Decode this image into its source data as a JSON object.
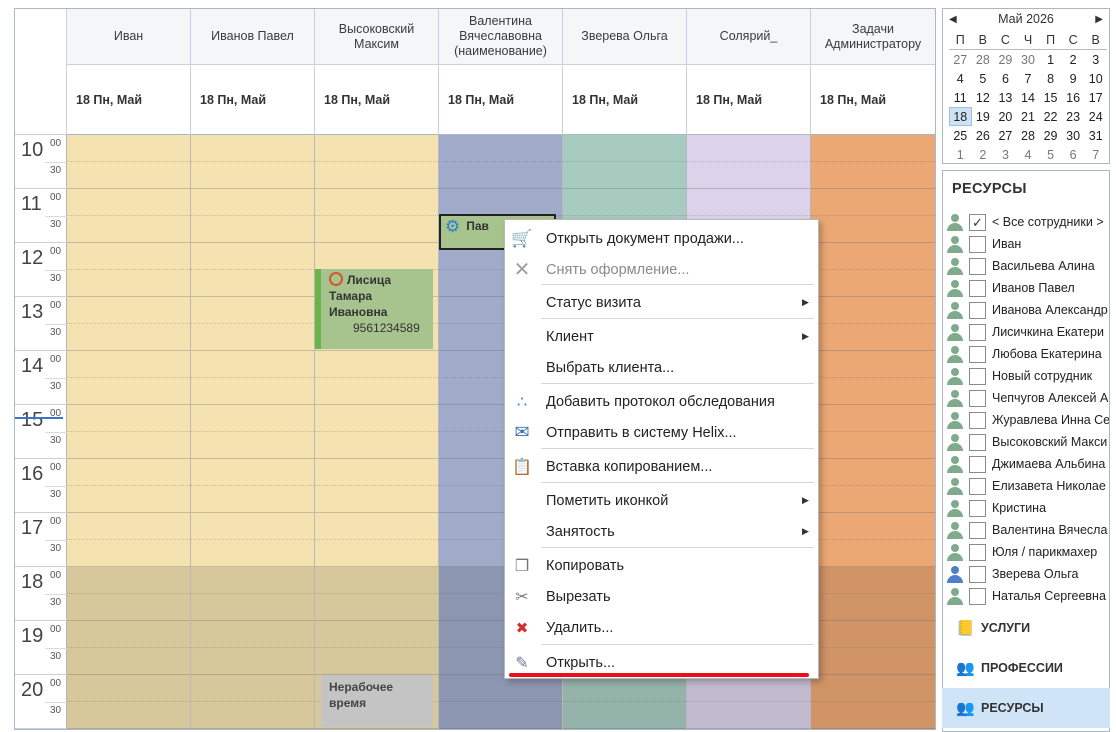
{
  "scheduler": {
    "resources": [
      {
        "name": "Иван",
        "date": "18 Пн, Май",
        "color": "#f4e3b1"
      },
      {
        "name": "Иванов Павел",
        "date": "18 Пн, Май",
        "color": "#f4e3b1"
      },
      {
        "name": "Высоковский Максим",
        "date": "18 Пн, Май",
        "color": "#f4e3b1"
      },
      {
        "name": "Валентина Вячеславовна (наименование)",
        "date": "18 Пн, Май",
        "color": "#a0abc9"
      },
      {
        "name": "Зверева Ольга",
        "date": "18 Пн, Май",
        "color": "#a8cbc0"
      },
      {
        "name": "Солярий_",
        "date": "18 Пн, Май",
        "color": "#dcd3ea"
      },
      {
        "name": "Задачи Администратору",
        "date": "18 Пн, Май",
        "color": "#eca874"
      }
    ],
    "hours": [
      "10",
      "11",
      "12",
      "13",
      "14",
      "15",
      "16",
      "17",
      "18",
      "19",
      "20"
    ],
    "min_00": "00",
    "min_30": "30",
    "appointment": {
      "name_line1": "Лисица",
      "name_line2": "Тамара",
      "name_line3": "Ивановна",
      "phone": "9561234589"
    },
    "selected_appointment": {
      "label": "Пав"
    },
    "non_working": {
      "line1": "Нерабочее",
      "line2": "время"
    }
  },
  "context_menu": [
    {
      "label": "Открыть документ продажи...",
      "icon": "cart-icon",
      "disabled": false,
      "submenu": false
    },
    {
      "label": "Снять оформление...",
      "icon": "cross-icon",
      "disabled": true,
      "submenu": false
    },
    {
      "label": "Статус визита",
      "icon": "",
      "disabled": false,
      "submenu": true
    },
    {
      "label": "Клиент",
      "icon": "",
      "disabled": false,
      "submenu": true
    },
    {
      "label": "Выбрать клиента...",
      "icon": "",
      "disabled": false,
      "submenu": false
    },
    {
      "label": "Добавить протокол обследования",
      "icon": "dots-icon",
      "disabled": false,
      "submenu": false
    },
    {
      "label": "Отправить в систему Helix...",
      "icon": "mail-icon",
      "disabled": false,
      "submenu": false
    },
    {
      "label": "Вставка копированием...",
      "icon": "clipboard-icon",
      "disabled": false,
      "submenu": false
    },
    {
      "label": "Пометить иконкой",
      "icon": "",
      "disabled": false,
      "submenu": true
    },
    {
      "label": "Занятость",
      "icon": "",
      "disabled": false,
      "submenu": true
    },
    {
      "label": "Копировать",
      "icon": "copy-icon",
      "disabled": false,
      "submenu": false
    },
    {
      "label": "Вырезать",
      "icon": "scissors-icon",
      "disabled": false,
      "submenu": false
    },
    {
      "label": "Удалить...",
      "icon": "delete-icon",
      "disabled": false,
      "submenu": false
    },
    {
      "label": "Открыть...",
      "icon": "open-icon",
      "disabled": false,
      "submenu": false
    }
  ],
  "calendar": {
    "title": "Май 2026",
    "dow": [
      "П",
      "В",
      "С",
      "Ч",
      "П",
      "С",
      "В"
    ],
    "days": [
      "27",
      "28",
      "29",
      "30",
      "1",
      "2",
      "3",
      "4",
      "5",
      "6",
      "7",
      "8",
      "9",
      "10",
      "11",
      "12",
      "13",
      "14",
      "15",
      "16",
      "17",
      "18",
      "19",
      "20",
      "21",
      "22",
      "23",
      "24",
      "25",
      "26",
      "27",
      "28",
      "29",
      "30",
      "31",
      "1",
      "2",
      "3",
      "4",
      "5",
      "6",
      "7"
    ],
    "today": "18"
  },
  "resources_panel": {
    "title": "РЕСУРСЫ",
    "items": [
      {
        "name": "< Все сотрудники >",
        "checked": true
      },
      {
        "name": "Иван",
        "checked": false
      },
      {
        "name": "Васильева Алина",
        "checked": false
      },
      {
        "name": "Иванов Павел",
        "checked": false
      },
      {
        "name": "Иванова Александр",
        "checked": false
      },
      {
        "name": "Лисичкина Екатери",
        "checked": false
      },
      {
        "name": "Любова Екатерина",
        "checked": false
      },
      {
        "name": "Новый сотрудник",
        "checked": false
      },
      {
        "name": "Чепчугов Алексей А",
        "checked": false
      },
      {
        "name": "Журавлева Инна Се",
        "checked": false
      },
      {
        "name": "Высоковский Макси",
        "checked": false
      },
      {
        "name": "Джимаева Альбина",
        "checked": false
      },
      {
        "name": "Елизавета Николае",
        "checked": false
      },
      {
        "name": "Кристина",
        "checked": false
      },
      {
        "name": "Валентина Вячесла",
        "checked": false
      },
      {
        "name": "Юля / парикмахер",
        "checked": false
      },
      {
        "name": "Зверева Ольга",
        "checked": false
      },
      {
        "name": "Наталья Сергеевна",
        "checked": false
      }
    ]
  },
  "accordion": [
    {
      "label": "УСЛУГИ",
      "icon": "services-icon",
      "active": false
    },
    {
      "label": "ПРОФЕССИИ",
      "icon": "professions-icon",
      "active": false
    },
    {
      "label": "РЕСУРСЫ",
      "icon": "resources-icon",
      "active": true
    }
  ]
}
